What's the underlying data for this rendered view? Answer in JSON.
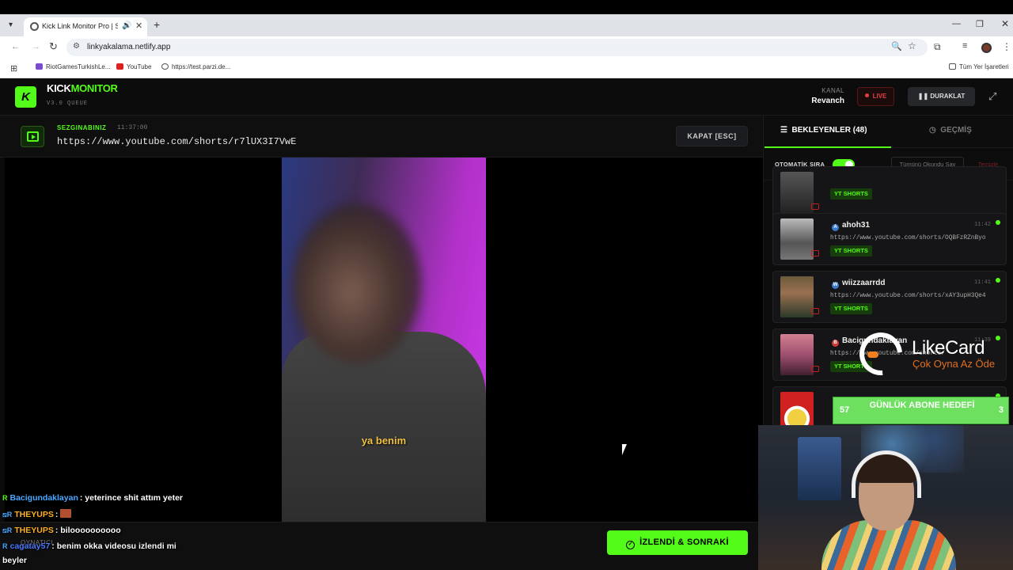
{
  "browser": {
    "tab_title": "Kick Link Monitor Pro | Stre",
    "url": "linkyakalama.netlify.app",
    "bookmarks": [
      "RiotGamesTurkishLe...",
      "YouTube",
      "https://test.parzi.de..."
    ],
    "all_bookmarks": "Tüm Yer İşaretleri"
  },
  "app": {
    "brand_kick": "KICK",
    "brand_monitor": "MONITOR",
    "version": "V3.0 QUEUE",
    "channel_label": "KANAL",
    "channel_name": "Revanch",
    "live_label": "LIVE",
    "pause_label": "DURAKLAT"
  },
  "current": {
    "user": "SEZGINABINIZ",
    "time": "11:37:00",
    "url": "https://www.youtube.com/shorts/r7lUX3I7VwE",
    "close_label": "KAPAT [ESC]",
    "caption": "ya benim",
    "done_label": "İZLENDİ & SONRAKİ"
  },
  "sidebar": {
    "tab_waiting": "BEKLEYENLER (48)",
    "tab_history": "GEÇMİŞ",
    "auto_queue_label": "OTOMATİK SIRA",
    "mark_all_label": "Tümünü Okundu Say",
    "clean_label": "Temizle",
    "items": [
      {
        "user": "",
        "time": "",
        "url": "",
        "tag": "YT SHORTS",
        "badge": ""
      },
      {
        "user": "ahoh31",
        "time": "11:42",
        "url": "https://www.youtube.com/shorts/OQBFzRZnByo",
        "tag": "YT SHORTS",
        "badge": "A"
      },
      {
        "user": "wiizzaarrdd",
        "time": "11:41",
        "url": "https://www.youtube.com/shorts/xAY3upH3Qe4",
        "tag": "YT SHORTS",
        "badge": "W"
      },
      {
        "user": "Bacigundaklayan",
        "time": "11:39",
        "url": "https://www.youtube.com/shorts/",
        "tag": "YT SHORTS",
        "badge": "B"
      },
      {
        "user": "",
        "time": "",
        "url": "",
        "tag": "",
        "badge": ""
      }
    ]
  },
  "overlay": {
    "likecard_name": "LikeCard",
    "likecard_tagline": "Çok Oyna Az Öde",
    "subgoal_left": "57",
    "subgoal_text": "GÜNLÜK ABONE HEDEFİ",
    "subgoal_right": "3",
    "oynatici": "OYNATICI"
  },
  "chat": [
    {
      "user": "Bacigundaklayan",
      "user_color": "#4aa8ff",
      "text": ": yeterince shit attım yeter"
    },
    {
      "user": "THEYUPS",
      "user_color": "#ffb020",
      "text": ":"
    },
    {
      "user": "THEYUPS",
      "user_color": "#ffb020",
      "text": ": biloooooooooo"
    },
    {
      "user": "cagatay57",
      "user_color": "#4a7aff",
      "text": ": benim okka videosu izlendi mi"
    },
    {
      "user": "",
      "user_color": "#ffffff",
      "text": "beyler"
    }
  ],
  "colors": {
    "accent": "#53fc18",
    "live": "#e04040"
  }
}
